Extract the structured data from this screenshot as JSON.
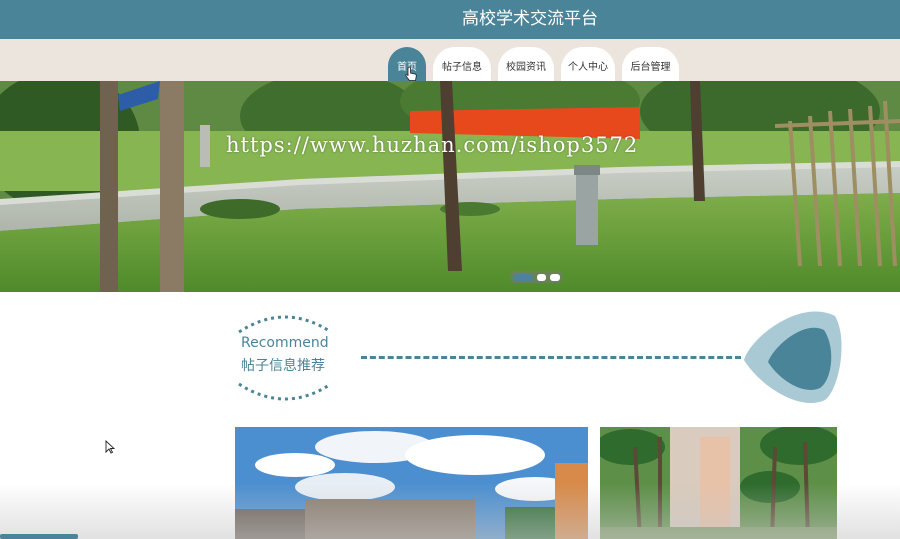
{
  "header": {
    "title": "高校学术交流平台"
  },
  "nav": {
    "items": [
      {
        "label": "首页",
        "active": true
      },
      {
        "label": "帖子信息",
        "active": false
      },
      {
        "label": "校园资讯",
        "active": false
      },
      {
        "label": "个人中心",
        "active": false
      },
      {
        "label": "后台管理",
        "active": false
      }
    ]
  },
  "banner": {
    "watermark": "https://www.huzhan.com/ishop3572",
    "carousel_dots": 3,
    "active_dot": 1
  },
  "recommend": {
    "en": "Recommend",
    "cn": "帖子信息推荐"
  },
  "colors": {
    "primary": "#4a8499",
    "nav_bg": "#ece5dd",
    "shape_outer": "#a9c9d4"
  }
}
